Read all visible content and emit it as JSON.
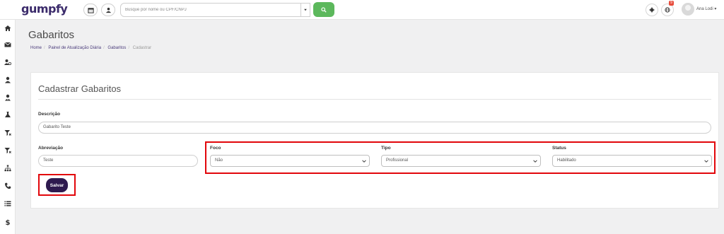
{
  "header": {
    "logo": "gumpfy",
    "search_placeholder": "Busque por nome ou CPF/CNPJ",
    "notification_count": "9",
    "user_name": "Ana Lodi"
  },
  "sidebar": {
    "icons": [
      "home-icon",
      "envelope-icon",
      "users-cog-icon",
      "user-icon",
      "user-tie-icon",
      "flask-icon",
      "filter-icon",
      "filter-alt-icon",
      "sitemap-icon",
      "phone-icon",
      "list-icon",
      "dollar-icon"
    ]
  },
  "page": {
    "title": "Gabaritos",
    "breadcrumb": [
      "Home",
      "Painel de Atualização Diária",
      "Gabaritos",
      "Cadastrar"
    ]
  },
  "form": {
    "title": "Cadastrar Gabaritos",
    "descricao_label": "Descrição",
    "descricao_value": "Gabarito Teste",
    "abreviacao_label": "Abreviação",
    "abreviacao_value": "Teste",
    "foco_label": "Foco",
    "foco_value": "Não",
    "tipo_label": "Tipo",
    "tipo_value": "Profissional",
    "status_label": "Status",
    "status_value": "Habilitado",
    "save_label": "Salvar"
  },
  "colors": {
    "brand": "#3b2b6b",
    "accent_green": "#5cb85c",
    "primary_button": "#2e1a4f",
    "highlight_red": "#e2060b"
  }
}
